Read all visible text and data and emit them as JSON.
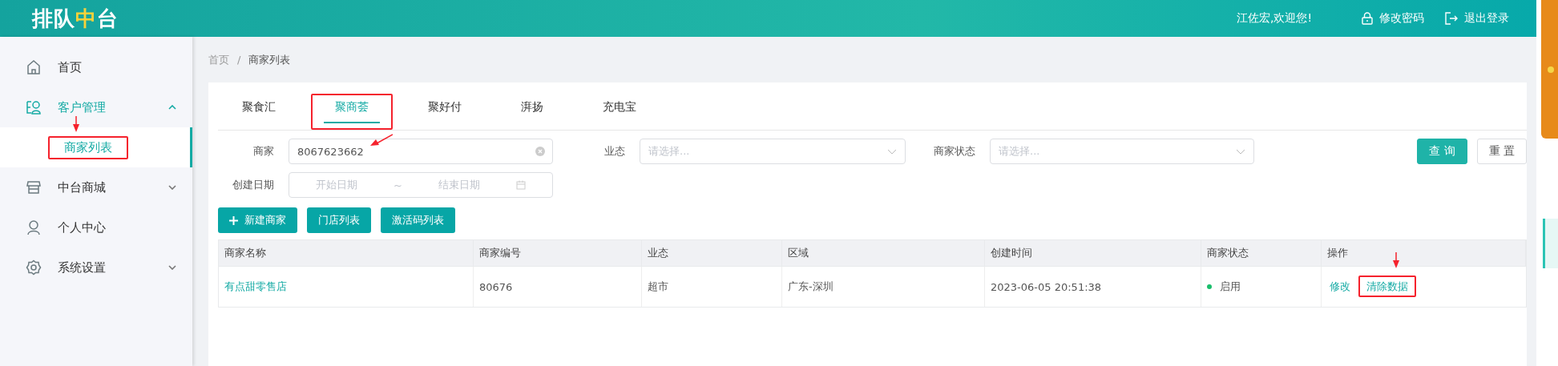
{
  "header": {
    "logo": [
      {
        "text": "排队",
        "accent": false
      },
      {
        "text": "中",
        "accent": true
      },
      {
        "text": "台",
        "accent": false
      }
    ],
    "welcome": "江佐宏,欢迎您!",
    "actions": [
      {
        "kind": "lock",
        "label": "修改密码"
      },
      {
        "kind": "logout",
        "label": "退出登录"
      }
    ]
  },
  "sidebar": {
    "items": [
      {
        "kind": "home",
        "label": "首页",
        "selected": false
      },
      {
        "kind": "users",
        "label": "客户管理",
        "expanded": true,
        "selected": true,
        "children": [
          {
            "label": "商家列表",
            "selected": true,
            "highlighted": true,
            "arrow": true
          }
        ]
      },
      {
        "kind": "store",
        "label": "中台商城",
        "expanded": false,
        "selected": false
      },
      {
        "kind": "person",
        "label": "个人中心",
        "selected": false
      },
      {
        "kind": "gear",
        "label": "系统设置",
        "expanded": false,
        "selected": false
      }
    ]
  },
  "breadcrumb": {
    "items": [
      "首页",
      "商家列表"
    ],
    "separator": "/"
  },
  "tabs": [
    {
      "label": "聚食汇",
      "selected": false,
      "highlighted": false
    },
    {
      "label": "聚商荟",
      "selected": true,
      "highlighted": true
    },
    {
      "label": "聚好付",
      "selected": false,
      "highlighted": false
    },
    {
      "label": "湃扬",
      "selected": false,
      "highlighted": false
    },
    {
      "label": "充电宝",
      "selected": false,
      "highlighted": false
    }
  ],
  "filters": {
    "merchant": {
      "label": "商家",
      "value": "8067623662",
      "arrow": true
    },
    "business": {
      "label": "业态",
      "placeholder": "请选择..."
    },
    "status": {
      "label": "商家状态",
      "placeholder": "请选择..."
    },
    "date": {
      "label": "创建日期",
      "start_placeholder": "开始日期",
      "separator": "~",
      "end_placeholder": "结束日期"
    },
    "search_button": "查 询",
    "reset_button": "重 置"
  },
  "toolbar": [
    {
      "kind": "add",
      "label": "新建商家"
    },
    {
      "kind": "plain",
      "label": "门店列表"
    },
    {
      "kind": "plain",
      "label": "激活码列表"
    }
  ],
  "table": {
    "columns": [
      "商家名称",
      "商家编号",
      "业态",
      "区域",
      "创建时间",
      "商家状态",
      "操作"
    ],
    "rows": [
      {
        "name": "有点甜零售店",
        "number": "80676",
        "business": "超市",
        "region": "广东-深圳",
        "created": "2023-06-05 20:51:38",
        "status": "启用",
        "color": "#19be6b",
        "actions": [
          {
            "label": "修改",
            "highlighted": false,
            "arrow": false
          },
          {
            "label": "清除数据",
            "highlighted": true,
            "arrow": true
          }
        ]
      }
    ]
  }
}
